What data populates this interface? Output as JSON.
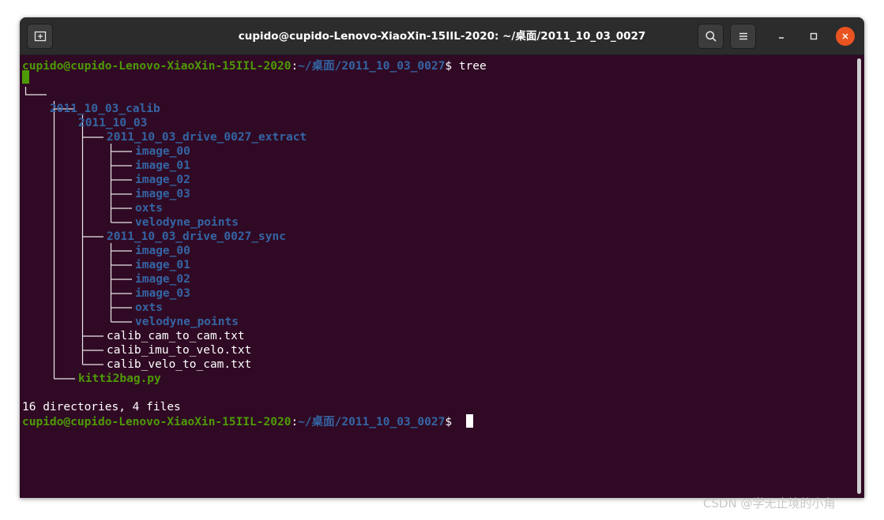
{
  "window": {
    "title": "cupido@cupido-Lenovo-XiaoXin-15IIL-2020: ~/桌面/2011_10_03_0027"
  },
  "prompt": {
    "user_host": "cupido@cupido-Lenovo-XiaoXin-15IIL-2020",
    "colon": ":",
    "path": "~/桌面/2011_10_03_0027",
    "symbol": "$ "
  },
  "command": "tree",
  "tree": {
    "root": "2011_10_03_calib",
    "date_dir": "2011_10_03",
    "extract_dir": "2011_10_03_drive_0027_extract",
    "extract_items": [
      "image_00",
      "image_01",
      "image_02",
      "image_03",
      "oxts",
      "velodyne_points"
    ],
    "sync_dir": "2011_10_03_drive_0027_sync",
    "sync_items": [
      "image_00",
      "image_01",
      "image_02",
      "image_03",
      "oxts",
      "velodyne_points"
    ],
    "files": [
      "calib_cam_to_cam.txt",
      "calib_imu_to_velo.txt",
      "calib_velo_to_cam.txt"
    ],
    "script": "kitti2bag.py"
  },
  "summary": "16 directories, 4 files",
  "colors": {
    "terminal_bg": "#300a24",
    "user_green": "#4e9a06",
    "path_blue": "#3465a4",
    "titlebar": "#2c2c2c",
    "close_orange": "#e95420"
  },
  "watermark": "CSDN @学无止境的小角"
}
